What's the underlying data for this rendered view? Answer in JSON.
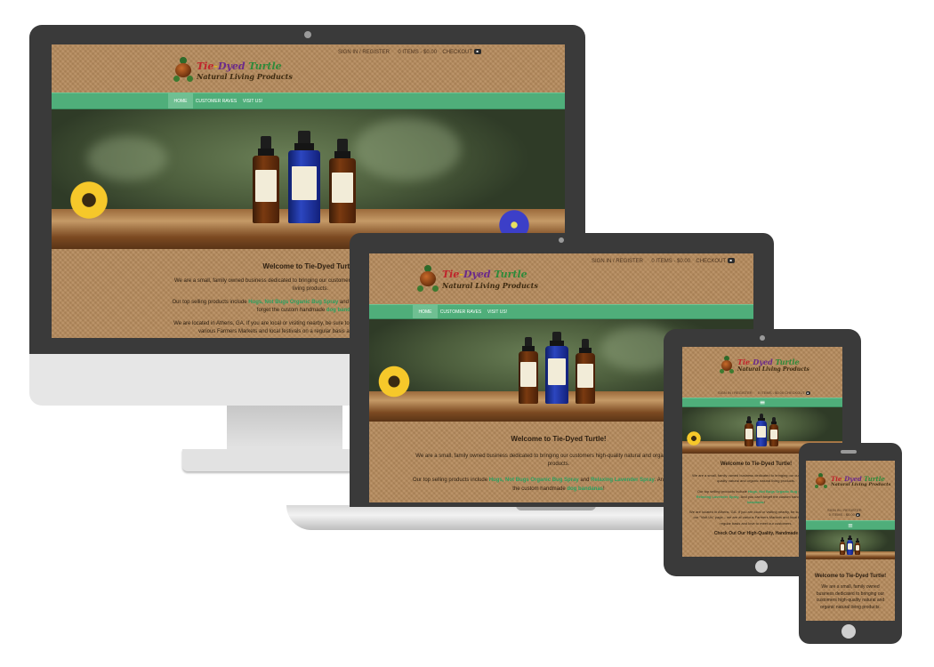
{
  "site": {
    "logo": {
      "line1_parts": [
        [
          "Tie",
          "r"
        ],
        [
          "-",
          "y"
        ],
        [
          "Dyed",
          "p"
        ],
        [
          " Turtle",
          "g"
        ]
      ],
      "line2": "Natural Living Products"
    },
    "top_links": {
      "signin": "SIGN IN / REGISTER",
      "cart": "0 ITEMS - $0.00",
      "checkout": "CHECKOUT"
    },
    "nav": [
      {
        "label": "HOME",
        "active": true
      },
      {
        "label": "CUSTOMER RAVES",
        "active": false
      },
      {
        "label": "VISIT US!",
        "active": false
      }
    ],
    "menu_icon": "≡",
    "bottle_label": "Hugs, not Bugs",
    "welcome": "Welcome to Tie-Dyed Turtle!",
    "p1": "We are a small, family owned business dedicated to bringing our customers high-quality natural and organic natural living products.",
    "p2_pre": "Our top selling products include ",
    "p2_link1": "Hugs, Not Bugs Organic Bug Spray",
    "p2_mid": " and ",
    "p2_link2": "Relaxing Lavender Spray",
    "p2_post": ". And you can't forget the custom handmade ",
    "p2_link3": "dog bandanas",
    "p2_end": "!",
    "p3": "We are located in Athens, GA. If you are local or visiting nearby, be sure to check out our \"Visit Us\" page – we are at various Farmers Markets and local festivals on a regular basis and love to meet our customers.",
    "cta": "Check Out Our High-Quality, Handmade"
  },
  "colors": {
    "nav_green": "#4fae7a",
    "link_green": "#2aa060",
    "burlap": "#b58a5c",
    "device_dark": "#3a3a3a",
    "stand_silver": "#d8d8d8"
  }
}
